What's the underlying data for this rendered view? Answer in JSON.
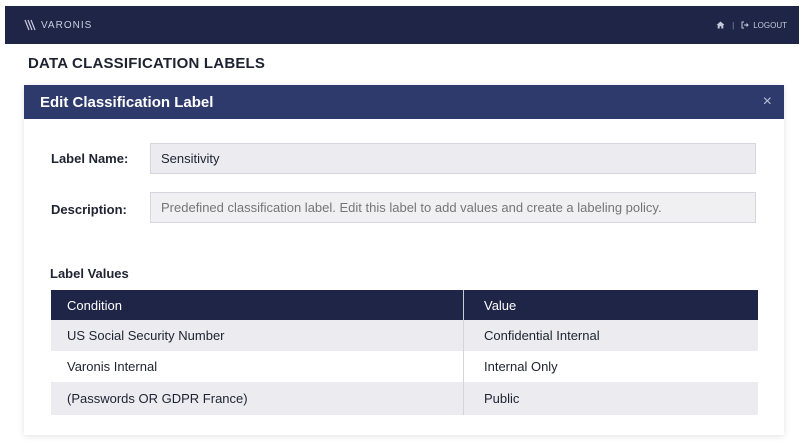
{
  "header": {
    "logo_text": "VARONIS",
    "separator": "|",
    "logout_label": "LOGOUT"
  },
  "page": {
    "title": "DATA CLASSIFICATION LABELS"
  },
  "dialog": {
    "title": "Edit Classification Label",
    "close_symbol": "×",
    "fields": {
      "label_name": {
        "label": "Label Name:",
        "value": "Sensitivity"
      },
      "description": {
        "label": "Description:",
        "placeholder": "Predefined classification label. Edit this label to add values and create a labeling policy."
      }
    },
    "label_values": {
      "title": "Label Values",
      "columns": [
        "Condition",
        "Value"
      ],
      "rows": [
        {
          "condition": "US Social Security Number",
          "value": "Confidential Internal"
        },
        {
          "condition": "Varonis Internal",
          "value": "Internal Only"
        },
        {
          "condition": "(Passwords OR GDPR France)",
          "value": "Public"
        }
      ]
    }
  },
  "colors": {
    "topbar": "#1e2547",
    "dialog_header": "#2e3a6b",
    "table_header": "#1e2547",
    "row_stripe": "#ebebf0"
  },
  "icons": {
    "logo": "varonis-logo-icon",
    "home": "home-icon",
    "logout": "logout-icon",
    "close": "close-icon"
  }
}
